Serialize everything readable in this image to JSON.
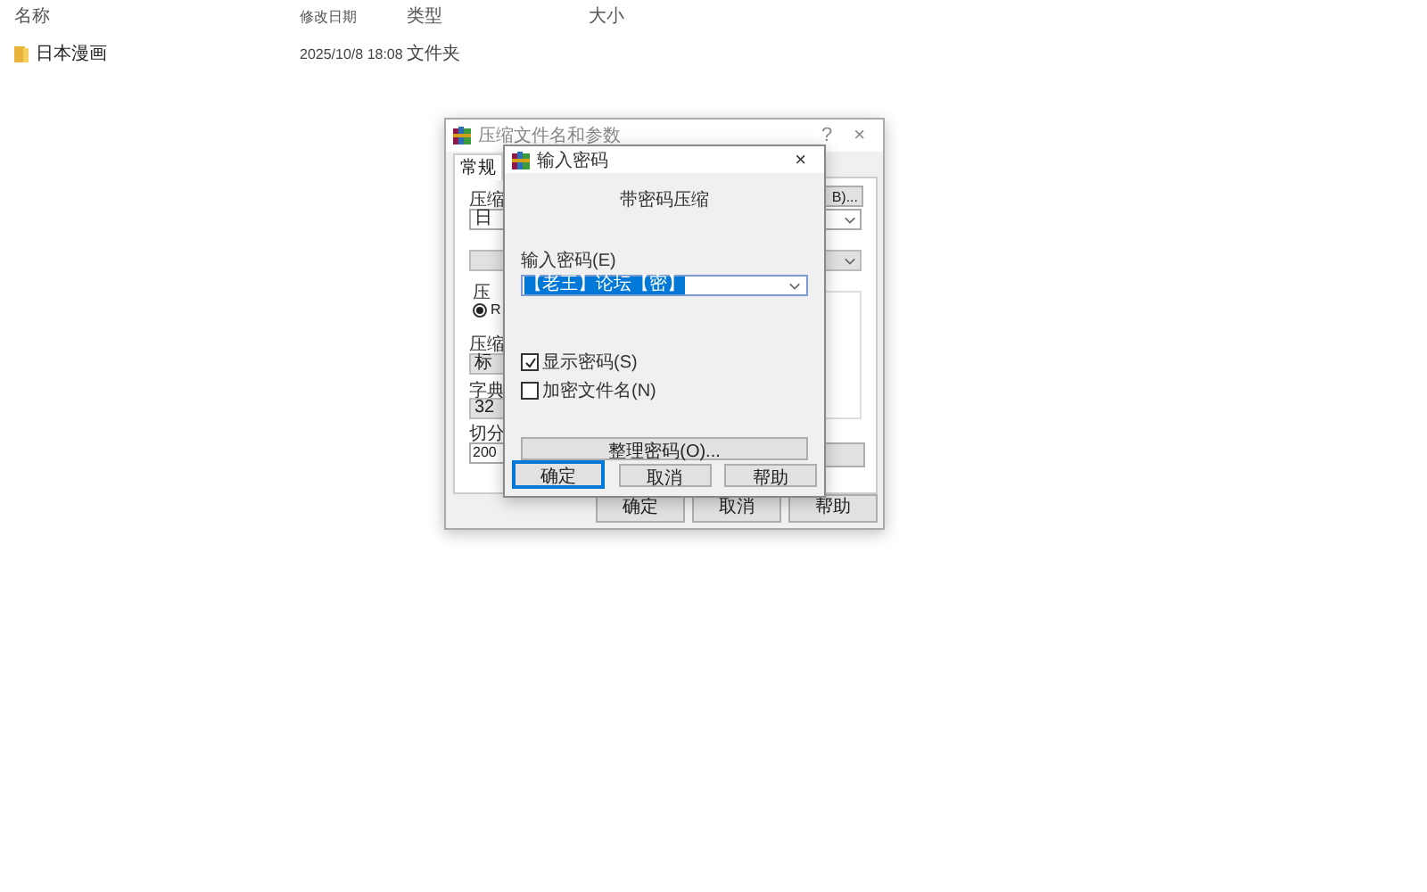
{
  "explorer": {
    "columns": [
      "名称",
      "修改日期",
      "类型",
      "大小"
    ],
    "rows": [
      {
        "name": "日本漫画",
        "modified": "2025/10/8 18:08",
        "type": "文件夹"
      }
    ]
  },
  "archive_dialog": {
    "title": "压缩文件名和参数",
    "help": "?",
    "close": "×",
    "tabs": [
      {
        "label": "常规",
        "selected": true
      }
    ],
    "archive_name_label": "压缩",
    "archive_name": "日",
    "browse_button": "B)...",
    "format_label": "压",
    "format_option": "R",
    "format_selected": true,
    "method_label": "压缩",
    "method": "标",
    "dictionary_label": "字典",
    "dictionary": "32",
    "split_label": "切分",
    "split": "200",
    "buttons": [
      "确定",
      "取消",
      "帮助"
    ]
  },
  "password_dialog": {
    "title": "输入密码",
    "close": "×",
    "heading": "带密码压缩",
    "password_label": "输入密码(E)",
    "password": "【老王】论坛【密】",
    "options": [
      {
        "label": "显示密码(S)",
        "checked": true
      },
      {
        "label": "加密文件名(N)",
        "checked": false
      }
    ],
    "organize_button": "整理密码(O)...",
    "buttons": [
      {
        "label": "确定",
        "default": true
      },
      {
        "label": "取消",
        "default": false
      },
      {
        "label": "帮助",
        "default": false
      }
    ]
  }
}
